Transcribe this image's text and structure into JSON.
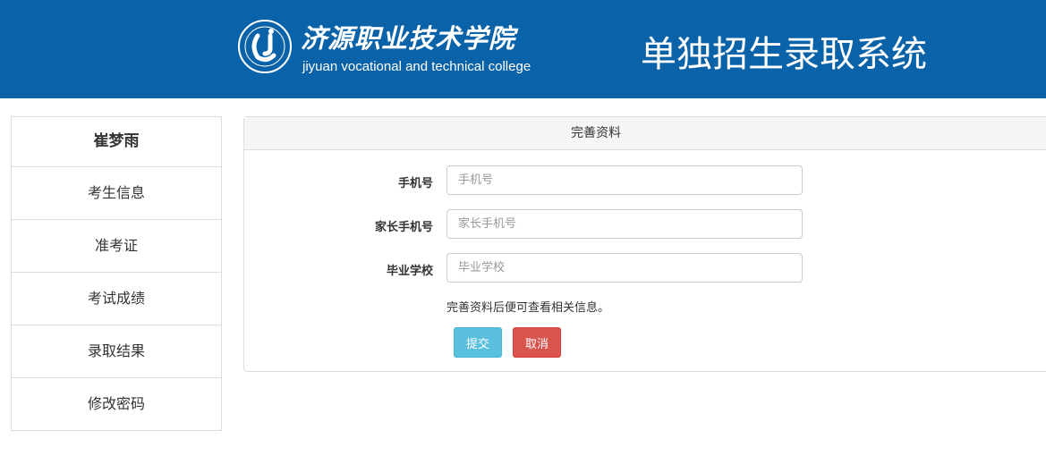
{
  "header": {
    "school_name_cn": "济源职业技术学院",
    "school_name_en": "jiyuan vocational and technical college",
    "system_title": "单独招生录取系统",
    "logo_icon": "college-emblem-icon"
  },
  "sidebar": {
    "user_name": "崔梦雨",
    "items": [
      {
        "label": "考生信息"
      },
      {
        "label": "准考证"
      },
      {
        "label": "考试成绩"
      },
      {
        "label": "录取结果"
      },
      {
        "label": "修改密码"
      }
    ]
  },
  "panel": {
    "title": "完善资料",
    "fields": [
      {
        "label": "手机号",
        "value": "",
        "placeholder": "手机号"
      },
      {
        "label": "家长手机号",
        "value": "",
        "placeholder": "家长手机号"
      },
      {
        "label": "毕业学校",
        "value": "",
        "placeholder": "毕业学校"
      }
    ],
    "hint": "完善资料后便可查看相关信息。",
    "submit_label": "提交",
    "cancel_label": "取消"
  },
  "colors": {
    "header_bg": "#0a63a8",
    "submit": "#5bc0de",
    "cancel": "#d9534f"
  }
}
